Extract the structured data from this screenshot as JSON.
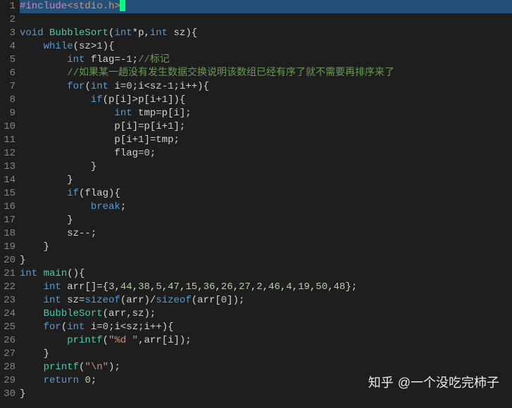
{
  "watermark": {
    "brand": "知乎",
    "at": "@一个没吃完柿子"
  },
  "lines": [
    {
      "n": 1,
      "hl": true,
      "cursor": true,
      "tokens": [
        {
          "c": "pre",
          "t": "#include"
        },
        {
          "c": "hdr",
          "t": "<stdio.h>"
        }
      ]
    },
    {
      "n": 2,
      "tokens": []
    },
    {
      "n": 3,
      "tokens": [
        {
          "c": "kw",
          "t": "void"
        },
        {
          "c": "op",
          "t": " "
        },
        {
          "c": "fn",
          "t": "BubbleSort"
        },
        {
          "c": "punc",
          "t": "("
        },
        {
          "c": "type",
          "t": "int"
        },
        {
          "c": "op",
          "t": "*"
        },
        {
          "c": "id",
          "t": "p"
        },
        {
          "c": "punc",
          "t": ","
        },
        {
          "c": "type",
          "t": "int"
        },
        {
          "c": "op",
          "t": " "
        },
        {
          "c": "id",
          "t": "sz"
        },
        {
          "c": "punc",
          "t": "){"
        }
      ]
    },
    {
      "n": 4,
      "indent": 4,
      "tokens": [
        {
          "c": "kw",
          "t": "while"
        },
        {
          "c": "punc",
          "t": "("
        },
        {
          "c": "id",
          "t": "sz"
        },
        {
          "c": "op",
          "t": ">"
        },
        {
          "c": "num",
          "t": "1"
        },
        {
          "c": "punc",
          "t": "){"
        }
      ]
    },
    {
      "n": 5,
      "indent": 8,
      "tokens": [
        {
          "c": "type",
          "t": "int"
        },
        {
          "c": "op",
          "t": " "
        },
        {
          "c": "id",
          "t": "flag"
        },
        {
          "c": "op",
          "t": "=-"
        },
        {
          "c": "num",
          "t": "1"
        },
        {
          "c": "punc",
          "t": ";"
        },
        {
          "c": "cmt",
          "t": "//标记"
        }
      ]
    },
    {
      "n": 6,
      "indent": 8,
      "tokens": [
        {
          "c": "cmt",
          "t": "//如果某一趟没有发生数据交换说明该数组已经有序了就不需要再排序来了"
        }
      ]
    },
    {
      "n": 7,
      "indent": 8,
      "tokens": [
        {
          "c": "kw",
          "t": "for"
        },
        {
          "c": "punc",
          "t": "("
        },
        {
          "c": "type",
          "t": "int"
        },
        {
          "c": "op",
          "t": " "
        },
        {
          "c": "id",
          "t": "i"
        },
        {
          "c": "op",
          "t": "="
        },
        {
          "c": "num",
          "t": "0"
        },
        {
          "c": "punc",
          "t": ";"
        },
        {
          "c": "id",
          "t": "i"
        },
        {
          "c": "op",
          "t": "<"
        },
        {
          "c": "id",
          "t": "sz"
        },
        {
          "c": "op",
          "t": "-"
        },
        {
          "c": "num",
          "t": "1"
        },
        {
          "c": "punc",
          "t": ";"
        },
        {
          "c": "id",
          "t": "i"
        },
        {
          "c": "op",
          "t": "++"
        },
        {
          "c": "punc",
          "t": "){"
        }
      ]
    },
    {
      "n": 8,
      "indent": 12,
      "tokens": [
        {
          "c": "kw",
          "t": "if"
        },
        {
          "c": "punc",
          "t": "("
        },
        {
          "c": "id",
          "t": "p"
        },
        {
          "c": "punc",
          "t": "["
        },
        {
          "c": "id",
          "t": "i"
        },
        {
          "c": "punc",
          "t": "]"
        },
        {
          "c": "op",
          "t": ">"
        },
        {
          "c": "id",
          "t": "p"
        },
        {
          "c": "punc",
          "t": "["
        },
        {
          "c": "id",
          "t": "i"
        },
        {
          "c": "op",
          "t": "+"
        },
        {
          "c": "num",
          "t": "1"
        },
        {
          "c": "punc",
          "t": "]){"
        }
      ]
    },
    {
      "n": 9,
      "indent": 16,
      "tokens": [
        {
          "c": "type",
          "t": "int"
        },
        {
          "c": "op",
          "t": " "
        },
        {
          "c": "id",
          "t": "tmp"
        },
        {
          "c": "op",
          "t": "="
        },
        {
          "c": "id",
          "t": "p"
        },
        {
          "c": "punc",
          "t": "["
        },
        {
          "c": "id",
          "t": "i"
        },
        {
          "c": "punc",
          "t": "];"
        }
      ]
    },
    {
      "n": 10,
      "indent": 16,
      "tokens": [
        {
          "c": "id",
          "t": "p"
        },
        {
          "c": "punc",
          "t": "["
        },
        {
          "c": "id",
          "t": "i"
        },
        {
          "c": "punc",
          "t": "]"
        },
        {
          "c": "op",
          "t": "="
        },
        {
          "c": "id",
          "t": "p"
        },
        {
          "c": "punc",
          "t": "["
        },
        {
          "c": "id",
          "t": "i"
        },
        {
          "c": "op",
          "t": "+"
        },
        {
          "c": "num",
          "t": "1"
        },
        {
          "c": "punc",
          "t": "];"
        }
      ]
    },
    {
      "n": 11,
      "indent": 16,
      "tokens": [
        {
          "c": "id",
          "t": "p"
        },
        {
          "c": "punc",
          "t": "["
        },
        {
          "c": "id",
          "t": "i"
        },
        {
          "c": "op",
          "t": "+"
        },
        {
          "c": "num",
          "t": "1"
        },
        {
          "c": "punc",
          "t": "]"
        },
        {
          "c": "op",
          "t": "="
        },
        {
          "c": "id",
          "t": "tmp"
        },
        {
          "c": "punc",
          "t": ";"
        }
      ]
    },
    {
      "n": 12,
      "indent": 16,
      "tokens": [
        {
          "c": "id",
          "t": "flag"
        },
        {
          "c": "op",
          "t": "="
        },
        {
          "c": "num",
          "t": "0"
        },
        {
          "c": "punc",
          "t": ";"
        }
      ]
    },
    {
      "n": 13,
      "indent": 12,
      "tokens": [
        {
          "c": "punc",
          "t": "}"
        }
      ]
    },
    {
      "n": 14,
      "indent": 8,
      "tokens": [
        {
          "c": "punc",
          "t": "}"
        }
      ]
    },
    {
      "n": 15,
      "indent": 8,
      "tokens": [
        {
          "c": "kw",
          "t": "if"
        },
        {
          "c": "punc",
          "t": "("
        },
        {
          "c": "id",
          "t": "flag"
        },
        {
          "c": "punc",
          "t": "){"
        }
      ]
    },
    {
      "n": 16,
      "indent": 12,
      "tokens": [
        {
          "c": "kw",
          "t": "break"
        },
        {
          "c": "punc",
          "t": ";"
        }
      ]
    },
    {
      "n": 17,
      "indent": 8,
      "tokens": [
        {
          "c": "punc",
          "t": "}"
        }
      ]
    },
    {
      "n": 18,
      "indent": 8,
      "tokens": [
        {
          "c": "id",
          "t": "sz"
        },
        {
          "c": "op",
          "t": "--"
        },
        {
          "c": "punc",
          "t": ";"
        }
      ]
    },
    {
      "n": 19,
      "indent": 4,
      "tokens": [
        {
          "c": "punc",
          "t": "}"
        }
      ]
    },
    {
      "n": 20,
      "tokens": [
        {
          "c": "punc",
          "t": "}"
        }
      ]
    },
    {
      "n": 21,
      "tokens": [
        {
          "c": "type",
          "t": "int"
        },
        {
          "c": "op",
          "t": " "
        },
        {
          "c": "fn",
          "t": "main"
        },
        {
          "c": "punc",
          "t": "(){"
        }
      ]
    },
    {
      "n": 22,
      "indent": 4,
      "tokens": [
        {
          "c": "type",
          "t": "int"
        },
        {
          "c": "op",
          "t": " "
        },
        {
          "c": "id",
          "t": "arr"
        },
        {
          "c": "punc",
          "t": "[]"
        },
        {
          "c": "op",
          "t": "="
        },
        {
          "c": "punc",
          "t": "{"
        },
        {
          "c": "num",
          "t": "3"
        },
        {
          "c": "punc",
          "t": ","
        },
        {
          "c": "num",
          "t": "44"
        },
        {
          "c": "punc",
          "t": ","
        },
        {
          "c": "num",
          "t": "38"
        },
        {
          "c": "punc",
          "t": ","
        },
        {
          "c": "num",
          "t": "5"
        },
        {
          "c": "punc",
          "t": ","
        },
        {
          "c": "num",
          "t": "47"
        },
        {
          "c": "punc",
          "t": ","
        },
        {
          "c": "num",
          "t": "15"
        },
        {
          "c": "punc",
          "t": ","
        },
        {
          "c": "num",
          "t": "36"
        },
        {
          "c": "punc",
          "t": ","
        },
        {
          "c": "num",
          "t": "26"
        },
        {
          "c": "punc",
          "t": ","
        },
        {
          "c": "num",
          "t": "27"
        },
        {
          "c": "punc",
          "t": ","
        },
        {
          "c": "num",
          "t": "2"
        },
        {
          "c": "punc",
          "t": ","
        },
        {
          "c": "num",
          "t": "46"
        },
        {
          "c": "punc",
          "t": ","
        },
        {
          "c": "num",
          "t": "4"
        },
        {
          "c": "punc",
          "t": ","
        },
        {
          "c": "num",
          "t": "19"
        },
        {
          "c": "punc",
          "t": ","
        },
        {
          "c": "num",
          "t": "50"
        },
        {
          "c": "punc",
          "t": ","
        },
        {
          "c": "num",
          "t": "48"
        },
        {
          "c": "punc",
          "t": "};"
        }
      ]
    },
    {
      "n": 23,
      "indent": 4,
      "tokens": [
        {
          "c": "type",
          "t": "int"
        },
        {
          "c": "op",
          "t": " "
        },
        {
          "c": "id",
          "t": "sz"
        },
        {
          "c": "op",
          "t": "="
        },
        {
          "c": "kw",
          "t": "sizeof"
        },
        {
          "c": "punc",
          "t": "("
        },
        {
          "c": "id",
          "t": "arr"
        },
        {
          "c": "punc",
          "t": ")/"
        },
        {
          "c": "kw",
          "t": "sizeof"
        },
        {
          "c": "punc",
          "t": "("
        },
        {
          "c": "id",
          "t": "arr"
        },
        {
          "c": "punc",
          "t": "["
        },
        {
          "c": "num",
          "t": "0"
        },
        {
          "c": "punc",
          "t": "]);"
        }
      ]
    },
    {
      "n": 24,
      "indent": 4,
      "tokens": [
        {
          "c": "fn",
          "t": "BubbleSort"
        },
        {
          "c": "punc",
          "t": "("
        },
        {
          "c": "id",
          "t": "arr"
        },
        {
          "c": "punc",
          "t": ","
        },
        {
          "c": "id",
          "t": "sz"
        },
        {
          "c": "punc",
          "t": ");"
        }
      ]
    },
    {
      "n": 25,
      "indent": 4,
      "tokens": [
        {
          "c": "kw",
          "t": "for"
        },
        {
          "c": "punc",
          "t": "("
        },
        {
          "c": "type",
          "t": "int"
        },
        {
          "c": "op",
          "t": " "
        },
        {
          "c": "id",
          "t": "i"
        },
        {
          "c": "op",
          "t": "="
        },
        {
          "c": "num",
          "t": "0"
        },
        {
          "c": "punc",
          "t": ";"
        },
        {
          "c": "id",
          "t": "i"
        },
        {
          "c": "op",
          "t": "<"
        },
        {
          "c": "id",
          "t": "sz"
        },
        {
          "c": "punc",
          "t": ";"
        },
        {
          "c": "id",
          "t": "i"
        },
        {
          "c": "op",
          "t": "++"
        },
        {
          "c": "punc",
          "t": "){"
        }
      ]
    },
    {
      "n": 26,
      "indent": 8,
      "tokens": [
        {
          "c": "fn",
          "t": "printf"
        },
        {
          "c": "punc",
          "t": "("
        },
        {
          "c": "str",
          "t": "\"%d \""
        },
        {
          "c": "punc",
          "t": ","
        },
        {
          "c": "id",
          "t": "arr"
        },
        {
          "c": "punc",
          "t": "["
        },
        {
          "c": "id",
          "t": "i"
        },
        {
          "c": "punc",
          "t": "]);"
        }
      ]
    },
    {
      "n": 27,
      "indent": 4,
      "tokens": [
        {
          "c": "punc",
          "t": "}"
        }
      ]
    },
    {
      "n": 28,
      "indent": 4,
      "tokens": [
        {
          "c": "fn",
          "t": "printf"
        },
        {
          "c": "punc",
          "t": "("
        },
        {
          "c": "str",
          "t": "\"\\n\""
        },
        {
          "c": "punc",
          "t": ");"
        }
      ]
    },
    {
      "n": 29,
      "indent": 4,
      "tokens": [
        {
          "c": "kw",
          "t": "return"
        },
        {
          "c": "op",
          "t": " "
        },
        {
          "c": "num",
          "t": "0"
        },
        {
          "c": "punc",
          "t": ";"
        }
      ]
    },
    {
      "n": 30,
      "tokens": [
        {
          "c": "punc",
          "t": "}"
        }
      ]
    }
  ]
}
